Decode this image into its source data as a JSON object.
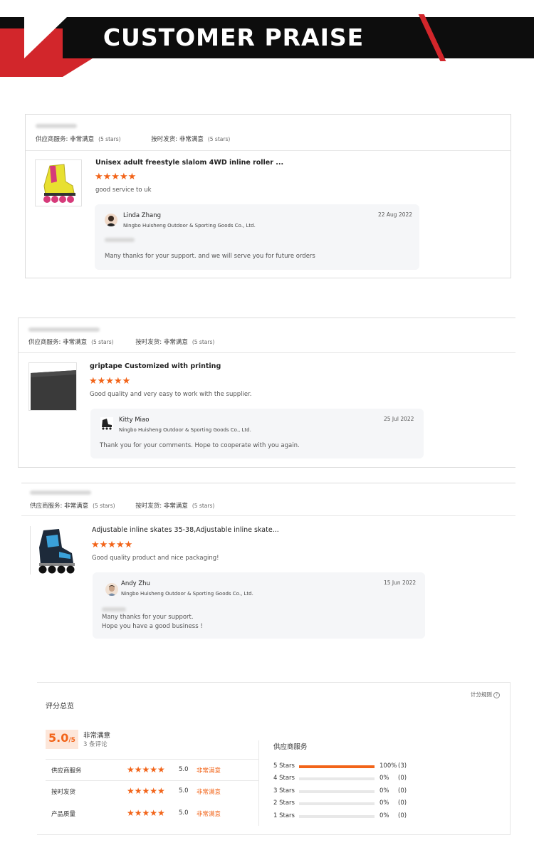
{
  "banner": {
    "title": "CUSTOMER PRAISE"
  },
  "colors": {
    "accent": "#f26419",
    "banner_black": "#0d0d0d",
    "banner_red": "#d2262b"
  },
  "rating_labels": {
    "supplier_service": "供应商服务:",
    "on_time_shipping": "按时发货:",
    "very_satisfied": "非常满意",
    "five_stars": "(5 stars)"
  },
  "reviews": [
    {
      "product_icon": "roller-skate-yellow-icon",
      "product_title": "Unisex adult freestyle slalom 4WD inline roller ...",
      "stars": "★★★★★",
      "comment": "good service to uk",
      "reply": {
        "name": "Linda Zhang",
        "company": "Ningbo Huisheng Outdoor & Sporting Goods Co., Ltd.",
        "date": "22 Aug 2022",
        "text_lines": [
          "Many thanks for your support. and we will serve you for future orders"
        ]
      }
    },
    {
      "product_icon": "griptape-sheet-icon",
      "product_title": "griptape Customized with printing",
      "stars": "★★★★★",
      "comment": "Good quality and very easy to work with the supplier.",
      "reply": {
        "name": "Kitty Miao",
        "company": "Ningbo Huisheng Outdoor & Sporting Goods Co., Ltd.",
        "date": "25 Jul 2022",
        "text_lines": [
          "Thank you for your comments. Hope to cooperate with you again."
        ]
      }
    },
    {
      "product_icon": "inline-skate-blue-icon",
      "product_title": "Adjustable inline skates 35-38,Adjustable inline skate...",
      "stars": "★★★★★",
      "comment": "Good quality product and nice packaging!",
      "reply": {
        "name": "Andy Zhu",
        "company": "Ningbo Huisheng Outdoor & Sporting Goods Co., Ltd.",
        "date": "15 Jun 2022",
        "text_lines": [
          "Many thanks for your support.",
          "Hope you have a good business !"
        ]
      }
    }
  ],
  "summary": {
    "title": "评分总览",
    "rules_link": "计分规则",
    "score": "5.0",
    "score_denominator": "/5",
    "score_label": "非常满意",
    "review_count": "3 条评论",
    "rows": [
      {
        "name": "供应商服务",
        "stars": "★★★★★",
        "value": "5.0",
        "desc": "非常满意"
      },
      {
        "name": "按时发货",
        "stars": "★★★★★",
        "value": "5.0",
        "desc": "非常满意"
      },
      {
        "name": "产品质量",
        "stars": "★★★★★",
        "value": "5.0",
        "desc": "非常满意"
      }
    ],
    "distribution_title": "供应商服务",
    "distribution": [
      {
        "label": "5 Stars",
        "fraction": 1.0,
        "percent": "100%",
        "count": "(3)"
      },
      {
        "label": "4 Stars",
        "fraction": 0.0,
        "percent": "0%",
        "count": "(0)"
      },
      {
        "label": "3 Stars",
        "fraction": 0.0,
        "percent": "0%",
        "count": "(0)"
      },
      {
        "label": "2 Stars",
        "fraction": 0.0,
        "percent": "0%",
        "count": "(0)"
      },
      {
        "label": "1 Stars",
        "fraction": 0.0,
        "percent": "0%",
        "count": "(0)"
      }
    ]
  }
}
